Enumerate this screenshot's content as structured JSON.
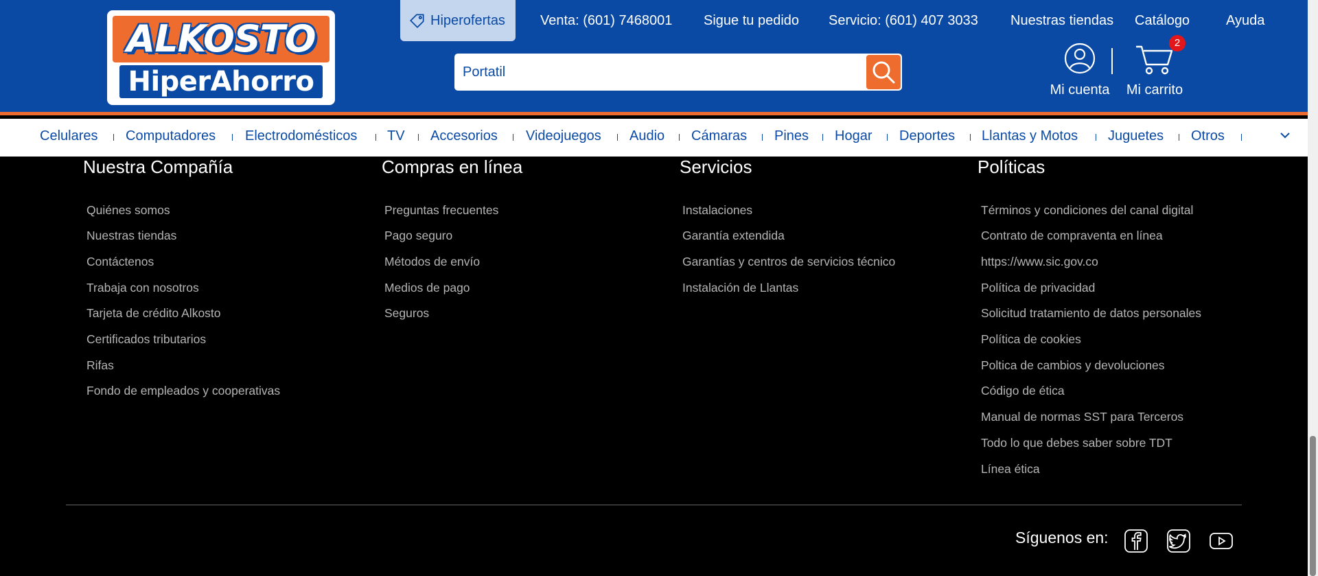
{
  "header": {
    "logo": {
      "top": "ALKOSTO",
      "bottom": "HiperAhorro"
    },
    "hiperofertas": "Hiperofertas",
    "links": [
      "Venta: (601) 7468001",
      "Sigue tu pedido",
      "Servicio: (601) 407 3033",
      "Nuestras tiendas",
      "Catálogo",
      "Ayuda"
    ],
    "search": {
      "value": "Portatil"
    },
    "account_label": "Mi cuenta",
    "cart_label": "Mi carrito",
    "cart_count": "2"
  },
  "categories": [
    "Celulares",
    "Computadores",
    "Electrodomésticos",
    "TV",
    "Accesorios",
    "Videojuegos",
    "Audio",
    "Cámaras",
    "Pines",
    "Hogar",
    "Deportes",
    "Llantas y Motos",
    "Juguetes",
    "Otros"
  ],
  "footer": {
    "columns": [
      {
        "title": "Nuestra Compañía",
        "links": [
          "Quiénes somos",
          "Nuestras tiendas",
          "Contáctenos",
          "Trabaja con nosotros",
          "Tarjeta de crédito Alkosto",
          "Certificados tributarios",
          "Rifas",
          "Fondo de empleados y cooperativas"
        ]
      },
      {
        "title": "Compras en línea",
        "links": [
          "Preguntas frecuentes",
          "Pago seguro",
          "Métodos de envío",
          "Medios de pago",
          "Seguros"
        ]
      },
      {
        "title": "Servicios",
        "links": [
          "Instalaciones",
          "Garantía extendida",
          "Garantías y centros de servicios técnico",
          "Instalación de Llantas"
        ]
      },
      {
        "title": "Políticas",
        "links": [
          "Términos y condiciones del canal digital",
          "Contrato de compraventa en línea",
          "https://www.sic.gov.co",
          "Política de privacidad",
          "Solicitud tratamiento de datos personales",
          "Política de cookies",
          "Poltica de cambios y devoluciones",
          "Código de ética",
          "Manual de normas SST para Terceros",
          "Todo lo que debes saber sobre TDT",
          "Línea ética"
        ]
      }
    ],
    "follow_label": "Síguenos en:",
    "social": [
      "facebook-icon",
      "twitter-icon",
      "youtube-icon"
    ]
  },
  "colors": {
    "brand_blue": "#0a4aa5",
    "brand_orange": "#ef6c2f",
    "badge_red": "#e3161a"
  }
}
